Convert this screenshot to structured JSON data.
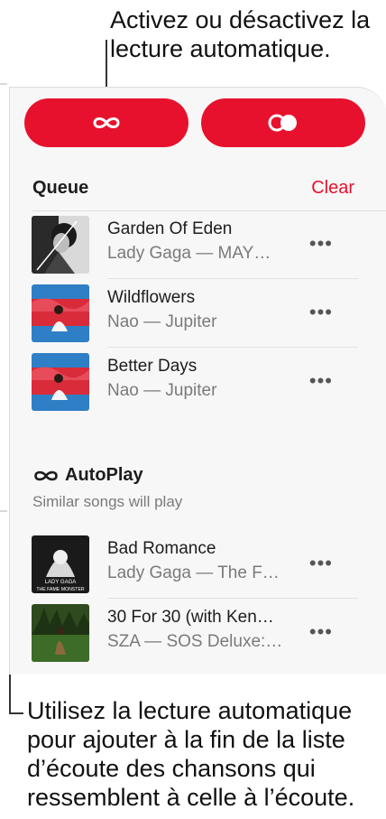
{
  "callouts": {
    "top": "Activez ou désactivez la lecture automatique.",
    "bottom": "Utilisez la lecture automatique pour ajouter à la fin de la liste d’écoute des chansons qui ressemblent à celle à l’écoute."
  },
  "panel": {
    "autoplay_icon": "infinity-icon",
    "shuffle_icon": "shuffle-icon"
  },
  "queue": {
    "title": "Queue",
    "clear_label": "Clear",
    "songs": [
      {
        "title": "Garden Of Eden",
        "subtitle": "Lady Gaga — MAY…",
        "more": "•••"
      },
      {
        "title": "Wildflowers",
        "subtitle": "Nao — Jupiter",
        "more": "•••"
      },
      {
        "title": "Better Days",
        "subtitle": "Nao — Jupiter",
        "more": "•••"
      }
    ]
  },
  "autoplay": {
    "title": "AutoPlay",
    "subtitle": "Similar songs will play",
    "songs": [
      {
        "title": "Bad Romance",
        "subtitle": "Lady Gaga — The F…",
        "more": "•••",
        "art_text_1": "LADY GAGA",
        "art_text_2": "THE FAME MONSTER"
      },
      {
        "title": "30 For 30 (with Ken…",
        "subtitle": "SZA — SOS Deluxe:…",
        "more": "•••"
      }
    ]
  },
  "colors": {
    "accent": "#e8112d",
    "secondary_text": "#7a7a7a"
  }
}
